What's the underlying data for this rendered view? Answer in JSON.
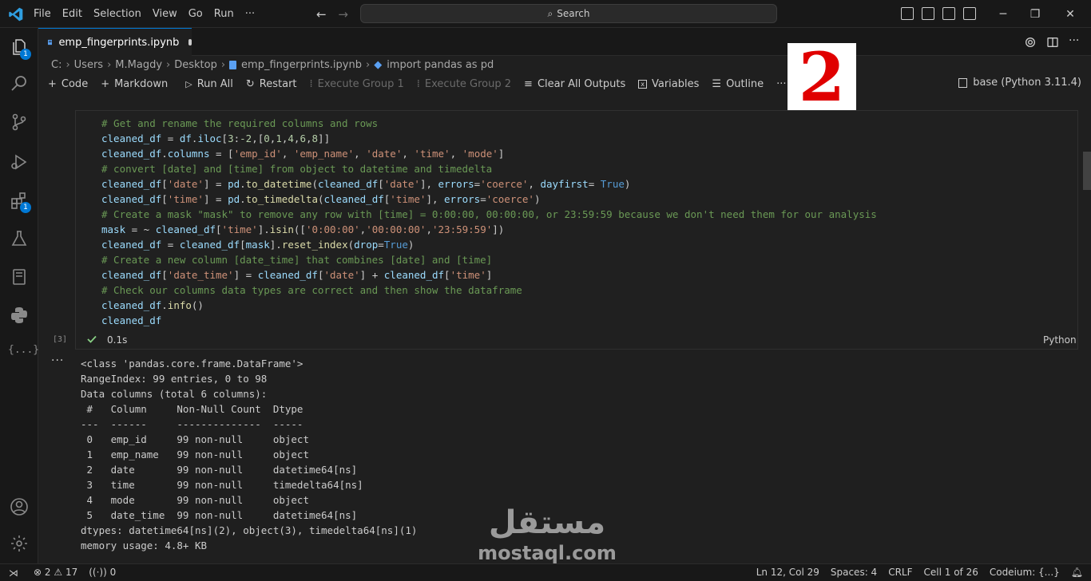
{
  "titlebar": {
    "menu": [
      "File",
      "Edit",
      "Selection",
      "View",
      "Go",
      "Run",
      "···"
    ],
    "search_label": "Search"
  },
  "activity": {
    "explorer_badge": "1",
    "extensions_badge": "1",
    "json_label": "{...}"
  },
  "tab": {
    "title": "emp_fingerprints.ipynb"
  },
  "breadcrumb": {
    "items": [
      "C:",
      "Users",
      "M.Magdy",
      "Desktop",
      "emp_fingerprints.ipynb",
      "import pandas as pd"
    ]
  },
  "toolbar": {
    "code": "Code",
    "markdown": "Markdown",
    "run_all": "Run All",
    "restart": "Restart",
    "execute_group_1": "Execute Group 1",
    "execute_group_2": "Execute Group 2",
    "clear_outputs": "Clear All Outputs",
    "variables": "Variables",
    "outline": "Outline",
    "more": "···",
    "kernel": "base (Python 3.11.4)"
  },
  "overlay_number": "2",
  "cell": {
    "exec_count": "[3]",
    "duration": "0.1s",
    "language": "Python"
  },
  "output": {
    "more": "···",
    "lines": [
      "<class 'pandas.core.frame.DataFrame'>",
      "RangeIndex: 99 entries, 0 to 98",
      "Data columns (total 6 columns):",
      " #   Column     Non-Null Count  Dtype          ",
      "---  ------     --------------  -----          ",
      " 0   emp_id     99 non-null     object         ",
      " 1   emp_name   99 non-null     object         ",
      " 2   date       99 non-null     datetime64[ns] ",
      " 3   time       99 non-null     timedelta64[ns]",
      " 4   mode       99 non-null     object         ",
      " 5   date_time  99 non-null     datetime64[ns] ",
      "dtypes: datetime64[ns](2), object(3), timedelta64[ns](1)",
      "memory usage: 4.8+ KB"
    ]
  },
  "watermark": {
    "arabic": "مستقل",
    "latin": "mostaql.com"
  },
  "statusbar": {
    "errors": "2",
    "warnings": "17",
    "ports": "0",
    "position": "Ln 12, Col 29",
    "spaces": "Spaces: 4",
    "eol": "CRLF",
    "cell": "Cell 1 of 26",
    "codeium": "Codeium: {...}"
  },
  "colors": {
    "accent": "#0078d4",
    "comment": "#6a9955",
    "string": "#ce9178",
    "number": "#b5cea8",
    "function": "#dcdcaa",
    "variable": "#9cdcfe",
    "keyword": "#569cd6",
    "success": "#89d185",
    "overlay_red": "#e00000"
  }
}
